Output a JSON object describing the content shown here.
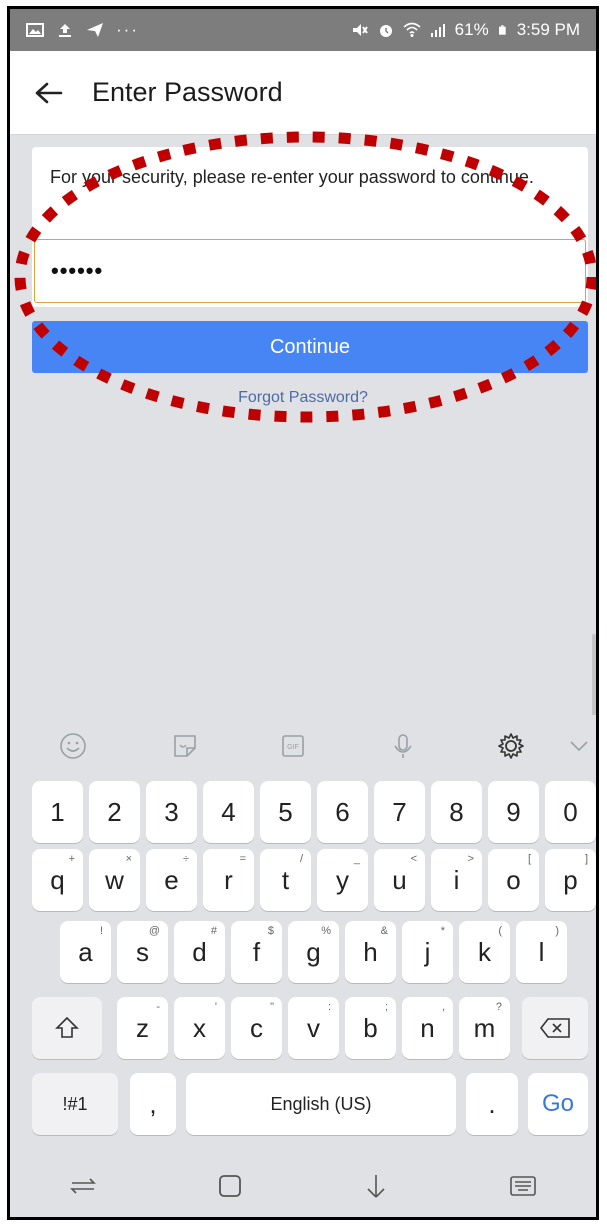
{
  "status_bar": {
    "battery": "61%",
    "time": "3:59 PM",
    "icons": [
      "image-icon",
      "upload-icon",
      "send-icon",
      "more-icon",
      "mute-icon",
      "alarm-icon",
      "wifi-icon",
      "signal-icon",
      "battery-icon"
    ]
  },
  "header": {
    "title": "Enter Password",
    "back_icon": "arrow-left-icon"
  },
  "form": {
    "message": "For your security, please re-enter your password to continue.",
    "password_value": "••••••",
    "continue_label": "Continue",
    "forgot_label": "Forgot Password?"
  },
  "colors": {
    "accent": "#4885F4",
    "highlight": "#C00000",
    "forgot_link": "#4D6AA6",
    "go_key": "#3A78D8"
  },
  "keyboard": {
    "toolbar": [
      "emoji-icon",
      "sticker-icon",
      "gif-icon",
      "mic-icon",
      "settings-icon",
      "collapse-icon"
    ],
    "rows": {
      "numbers": [
        "1",
        "2",
        "3",
        "4",
        "5",
        "6",
        "7",
        "8",
        "9",
        "0"
      ],
      "row1": [
        {
          "k": "q",
          "s": "+"
        },
        {
          "k": "w",
          "s": "×"
        },
        {
          "k": "e",
          "s": "÷"
        },
        {
          "k": "r",
          "s": "="
        },
        {
          "k": "t",
          "s": "/"
        },
        {
          "k": "y",
          "s": "_"
        },
        {
          "k": "u",
          "s": "<"
        },
        {
          "k": "i",
          "s": ">"
        },
        {
          "k": "o",
          "s": "["
        },
        {
          "k": "p",
          "s": "]"
        }
      ],
      "row2": [
        {
          "k": "a",
          "s": "!"
        },
        {
          "k": "s",
          "s": "@"
        },
        {
          "k": "d",
          "s": "#"
        },
        {
          "k": "f",
          "s": "$"
        },
        {
          "k": "g",
          "s": "%"
        },
        {
          "k": "h",
          "s": "&"
        },
        {
          "k": "j",
          "s": "*"
        },
        {
          "k": "k",
          "s": "("
        },
        {
          "k": "l",
          "s": ")"
        }
      ],
      "row3": [
        {
          "k": "z",
          "s": "-"
        },
        {
          "k": "x",
          "s": "'"
        },
        {
          "k": "c",
          "s": "\""
        },
        {
          "k": "v",
          "s": ":"
        },
        {
          "k": "b",
          "s": ";"
        },
        {
          "k": "n",
          "s": ","
        },
        {
          "k": "m",
          "s": "?"
        }
      ]
    },
    "sym_label": "!#1",
    "comma_label": ",",
    "space_label": "English (US)",
    "period_label": ".",
    "go_label": "Go"
  },
  "navbar": [
    "recents-icon",
    "home-icon",
    "back-icon",
    "keyboard-icon"
  ]
}
